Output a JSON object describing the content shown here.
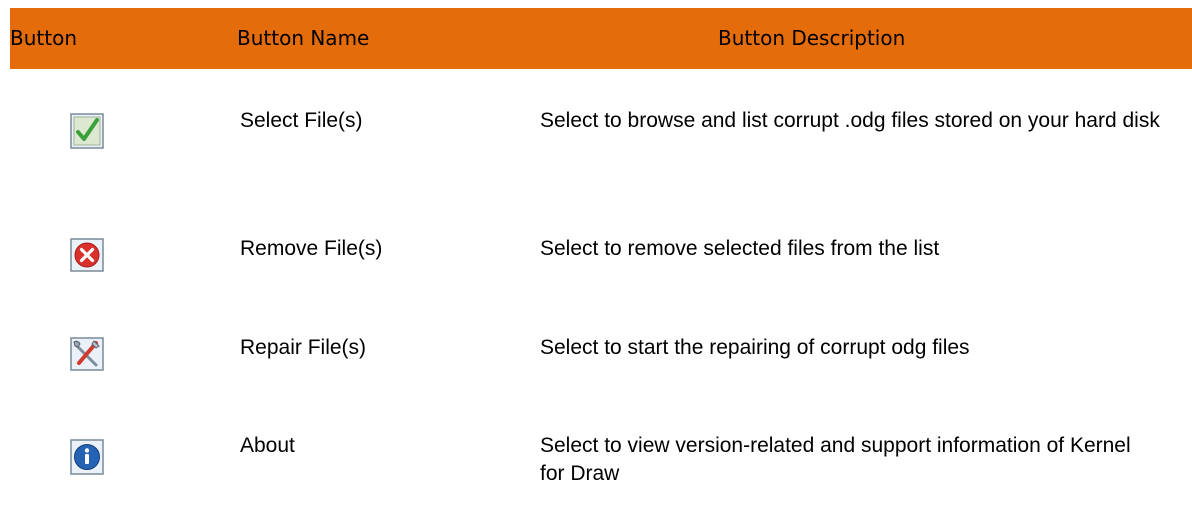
{
  "header": {
    "button": "Button",
    "button_name": "Button Name",
    "button_description": "Button Description"
  },
  "rows": [
    {
      "icon": "select-files-icon",
      "name": "Select File(s)",
      "description": "Select to browse and list corrupt .odg files stored on your hard disk"
    },
    {
      "icon": "remove-files-icon",
      "name": "Remove File(s)",
      "description": "Select to remove selected files from the list"
    },
    {
      "icon": "repair-files-icon",
      "name": "Repair File(s)",
      "description": "Select to start the repairing of corrupt odg files"
    },
    {
      "icon": "about-icon",
      "name": "About",
      "description": "Select to view version-related and support information of Kernel for Draw"
    }
  ],
  "colors": {
    "header_bg": "#e46c0a"
  }
}
